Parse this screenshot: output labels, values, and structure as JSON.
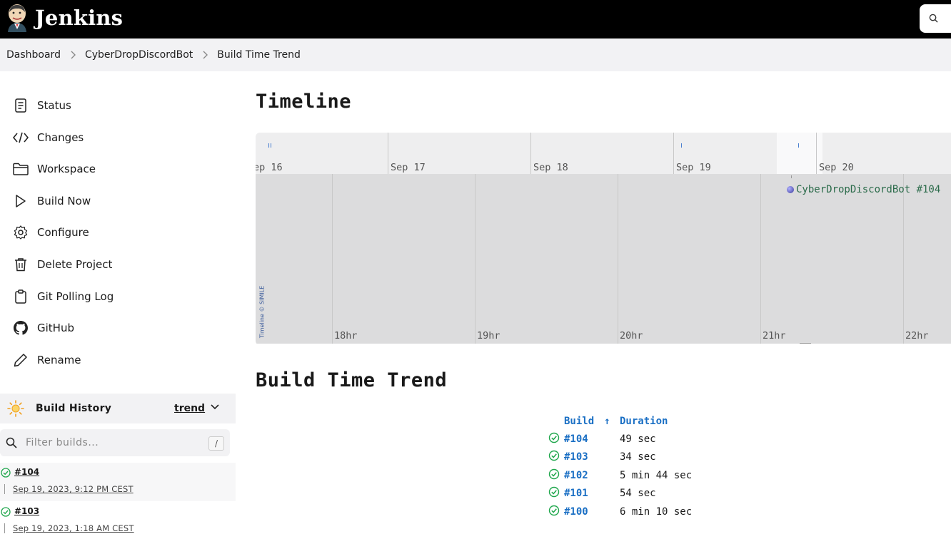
{
  "header": {
    "brand": "Jenkins",
    "logo_icon": "jenkins-butler-logo",
    "search_icon": "search-icon"
  },
  "breadcrumb": {
    "items": [
      "Dashboard",
      "CyberDropDiscordBot",
      "Build Time Trend"
    ]
  },
  "sidebar": {
    "tasks": [
      {
        "label": "Status",
        "icon": "document-icon"
      },
      {
        "label": "Changes",
        "icon": "code-icon"
      },
      {
        "label": "Workspace",
        "icon": "folder-icon"
      },
      {
        "label": "Build Now",
        "icon": "play-icon"
      },
      {
        "label": "Configure",
        "icon": "gear-icon"
      },
      {
        "label": "Delete Project",
        "icon": "trash-icon"
      },
      {
        "label": "Git Polling Log",
        "icon": "clipboard-icon"
      },
      {
        "label": "GitHub",
        "icon": "github-icon"
      },
      {
        "label": "Rename",
        "icon": "pencil-icon"
      }
    ],
    "build_history": {
      "title": "Build History",
      "trend_label": "trend",
      "filter_placeholder": "Filter builds...",
      "filter_shortcut": "/",
      "entries": [
        {
          "number": "#104",
          "date": "Sep 19, 2023, 9:12 PM CEST"
        },
        {
          "number": "#103",
          "date": "Sep 19, 2023, 1:18 AM CEST"
        }
      ]
    }
  },
  "timeline": {
    "heading": "Timeline",
    "day_labels": [
      "ep 16",
      "Sep 17",
      "Sep 18",
      "Sep 19",
      "Sep 20"
    ],
    "hour_labels": [
      "18hr",
      "19hr",
      "20hr",
      "21hr",
      "22hr"
    ],
    "event_label": "CyberDropDiscordBot #104",
    "credit": "Timeline © SIMILE"
  },
  "trend": {
    "heading": "Build Time Trend",
    "col_build": "Build",
    "sort_indicator": "↑",
    "col_duration": "Duration",
    "status_colors": {
      "success": "#1ea64b"
    },
    "rows": [
      {
        "build": "#104",
        "duration": "49 sec",
        "status": "success"
      },
      {
        "build": "#103",
        "duration": "34 sec",
        "status": "success"
      },
      {
        "build": "#102",
        "duration": "5 min 44 sec",
        "status": "success"
      },
      {
        "build": "#101",
        "duration": "54 sec",
        "status": "success"
      },
      {
        "build": "#100",
        "duration": "6 min 10 sec",
        "status": "success"
      }
    ]
  }
}
